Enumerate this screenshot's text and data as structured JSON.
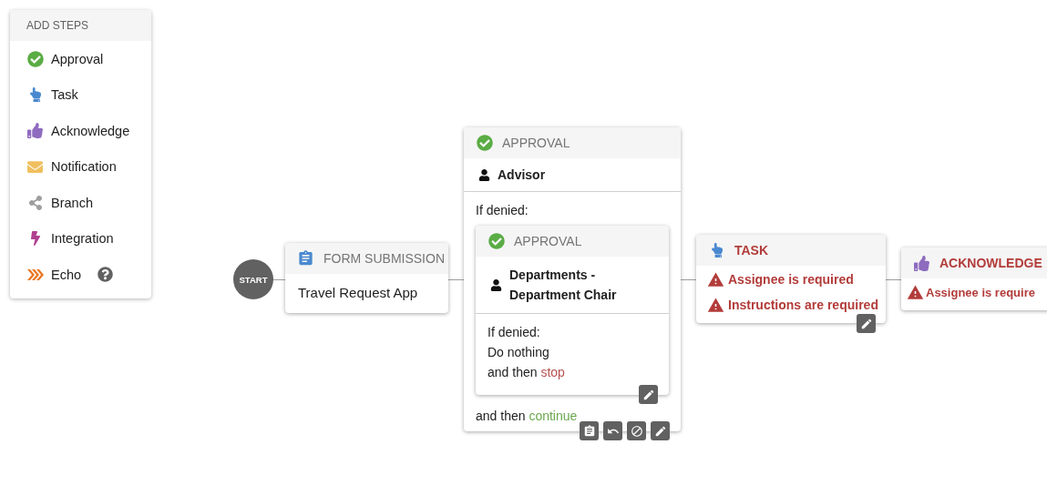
{
  "palette": {
    "title": "ADD STEPS",
    "items": [
      {
        "kind": "approval",
        "label": "Approval",
        "help": false
      },
      {
        "kind": "task",
        "label": "Task",
        "help": false
      },
      {
        "kind": "acknowledge",
        "label": "Acknowledge",
        "help": false
      },
      {
        "kind": "notification",
        "label": "Notification",
        "help": false
      },
      {
        "kind": "branch",
        "label": "Branch",
        "help": false
      },
      {
        "kind": "integration",
        "label": "Integration",
        "help": false
      },
      {
        "kind": "echo",
        "label": "Echo",
        "help": true
      }
    ]
  },
  "workflow": {
    "start": {
      "label": "START"
    },
    "form": {
      "kind": "form",
      "title": "FORM SUBMISSION",
      "body": "Travel Request App"
    },
    "approval": {
      "kind": "approval",
      "title": "APPROVAL",
      "assignee": "Advisor",
      "denied_label": "If denied:",
      "nested": {
        "kind": "approval",
        "title": "APPROVAL",
        "assignee": "Departments - Department Chair",
        "denied_label": "If denied:",
        "denied_action": "Do nothing",
        "then": {
          "prefix": "and then",
          "action": "stop",
          "kind": "stop"
        }
      },
      "then": {
        "prefix": "and then",
        "action": "continue",
        "kind": "continue"
      },
      "actions": [
        {
          "kind": "copy"
        },
        {
          "kind": "undo"
        },
        {
          "kind": "disable"
        },
        {
          "kind": "edit"
        }
      ]
    },
    "task": {
      "kind": "task",
      "title": "TASK",
      "errors": [
        "Assignee is required",
        "Instructions are required"
      ]
    },
    "acknowledge": {
      "kind": "acknowledge",
      "title": "ACKNOWLEDGE",
      "errors": [
        "Assignee is require"
      ]
    }
  }
}
